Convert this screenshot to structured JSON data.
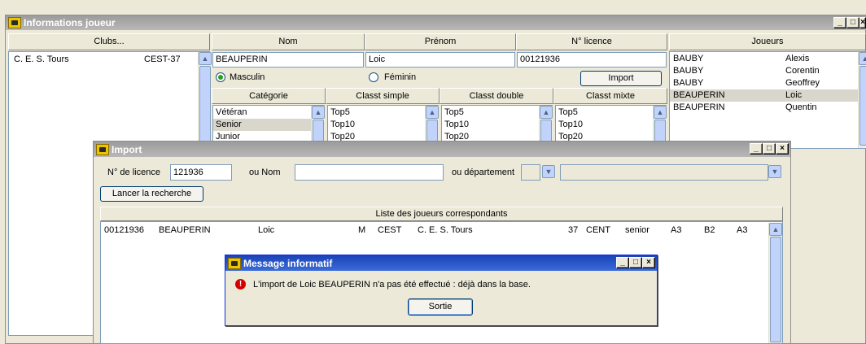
{
  "main": {
    "title": "Informations joueur",
    "clubs_header": "Clubs...",
    "clubs": [
      {
        "name": "C. E. S. Tours",
        "code": "CEST-37"
      }
    ],
    "headers": {
      "nom": "Nom",
      "prenom": "Prénom",
      "licence": "N° licence",
      "joueurs": "Joueurs"
    },
    "values": {
      "nom": "BEAUPERIN",
      "prenom": "Loic",
      "licence": "00121936"
    },
    "gender": {
      "masculin": "Masculin",
      "feminin": "Féminin"
    },
    "import_label": "Import",
    "cols": {
      "categorie": "Catégorie",
      "simple": "Classt simple",
      "double": "Classt double",
      "mixte": "Classt mixte"
    },
    "categories": [
      "Vétéran",
      "Senior",
      "Junior"
    ],
    "classt": [
      "Top5",
      "Top10",
      "Top20"
    ],
    "joueurs": [
      {
        "nom": "BAUBY",
        "prenom": "Alexis"
      },
      {
        "nom": "BAUBY",
        "prenom": "Corentin"
      },
      {
        "nom": "BAUBY",
        "prenom": "Geoffrey"
      },
      {
        "nom": "BEAUPERIN",
        "prenom": "Loic"
      },
      {
        "nom": "BEAUPERIN",
        "prenom": "Quentin"
      }
    ]
  },
  "import": {
    "title": "Import",
    "licence_label": "N° de licence",
    "licence_value": "121936",
    "nom_label": "ou Nom",
    "dept_label": "ou département",
    "search_label": "Lancer la recherche",
    "list_header": "Liste des joueurs correspondants",
    "result": {
      "licence": "00121936",
      "nom": "BEAUPERIN",
      "prenom": "Loic",
      "sexe": "M",
      "club_code": "CEST",
      "club": "C. E. S. Tours",
      "dept": "37",
      "ligue": "CENT",
      "categorie": "senior",
      "simple": "A3",
      "double": "B2",
      "mixte": "A3"
    }
  },
  "message": {
    "title": "Message informatif",
    "text": "L'import de Loic BEAUPERIN n'a pas été effectué : déjà dans la base.",
    "button": "Sortie"
  },
  "colors": {
    "title_active": "#1a43b8",
    "title_inactive": "#9b9b9b",
    "error_icon": "#d40000"
  }
}
